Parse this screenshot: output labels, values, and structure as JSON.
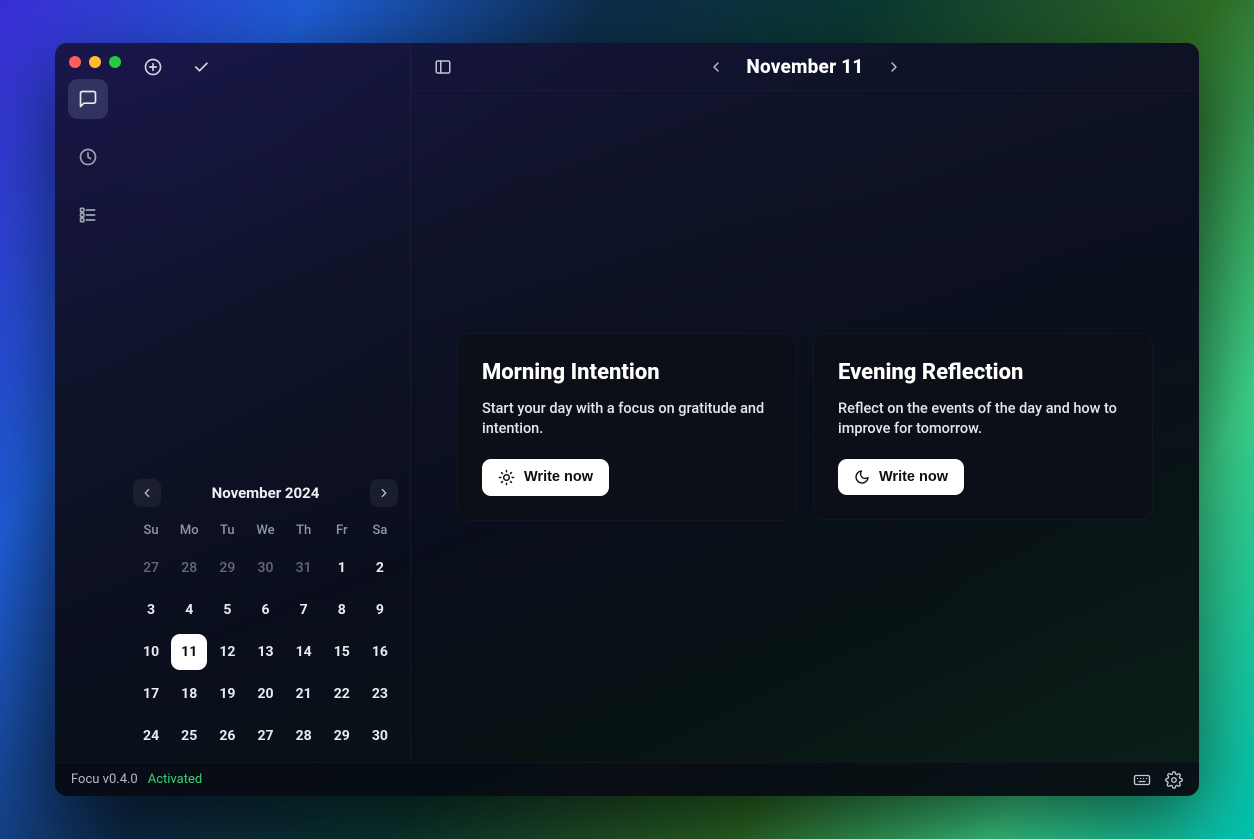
{
  "header": {
    "date_title": "November 11"
  },
  "rail": {
    "items": [
      {
        "icon": "chat-bubble-icon",
        "active": true
      },
      {
        "icon": "clock-icon",
        "active": false
      },
      {
        "icon": "list-icon",
        "active": false
      }
    ]
  },
  "sidebar_top": {
    "add_icon": "add-circle-icon",
    "check_icon": "check-icon"
  },
  "calendar": {
    "month_label": "November 2024",
    "day_headers": [
      "Su",
      "Mo",
      "Tu",
      "We",
      "Th",
      "Fr",
      "Sa"
    ],
    "weeks": [
      [
        {
          "d": "27",
          "o": true
        },
        {
          "d": "28",
          "o": true
        },
        {
          "d": "29",
          "o": true
        },
        {
          "d": "30",
          "o": true
        },
        {
          "d": "31",
          "o": true
        },
        {
          "d": "1"
        },
        {
          "d": "2"
        }
      ],
      [
        {
          "d": "3"
        },
        {
          "d": "4"
        },
        {
          "d": "5"
        },
        {
          "d": "6"
        },
        {
          "d": "7"
        },
        {
          "d": "8"
        },
        {
          "d": "9"
        }
      ],
      [
        {
          "d": "10"
        },
        {
          "d": "11",
          "sel": true
        },
        {
          "d": "12"
        },
        {
          "d": "13"
        },
        {
          "d": "14"
        },
        {
          "d": "15"
        },
        {
          "d": "16"
        }
      ],
      [
        {
          "d": "17"
        },
        {
          "d": "18"
        },
        {
          "d": "19"
        },
        {
          "d": "20"
        },
        {
          "d": "21"
        },
        {
          "d": "22"
        },
        {
          "d": "23"
        }
      ],
      [
        {
          "d": "24"
        },
        {
          "d": "25"
        },
        {
          "d": "26"
        },
        {
          "d": "27"
        },
        {
          "d": "28"
        },
        {
          "d": "29"
        },
        {
          "d": "30"
        }
      ]
    ]
  },
  "cards": {
    "morning": {
      "title": "Morning Intention",
      "desc": "Start your day with a focus on gratitude and intention.",
      "button": "Write now"
    },
    "evening": {
      "title": "Evening Reflection",
      "desc": "Reflect on the events of the day and how to improve for tomorrow.",
      "button": "Write now"
    }
  },
  "statusbar": {
    "app_label": "Focu v0.4.0",
    "status": "Activated"
  }
}
